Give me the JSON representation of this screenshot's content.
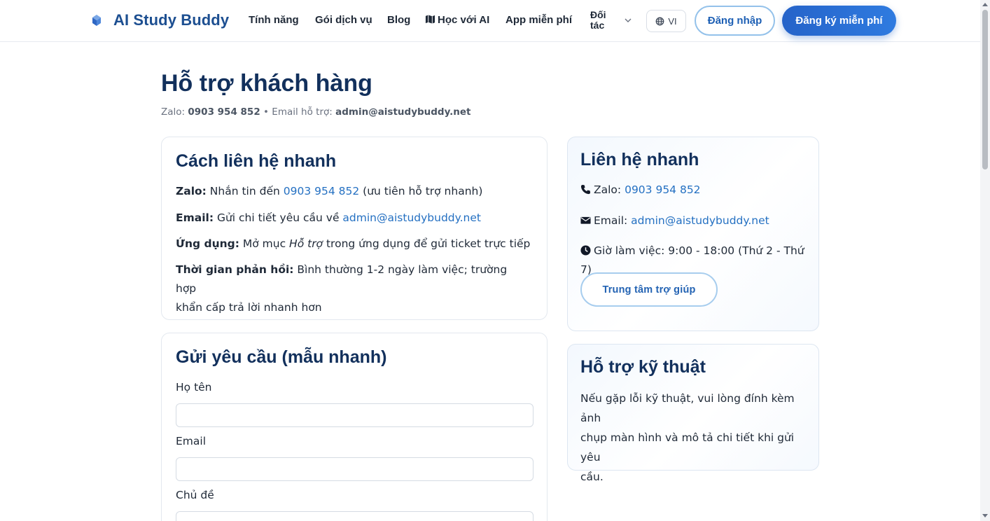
{
  "header": {
    "brand_name": "AI Study Buddy",
    "nav": {
      "features": "Tính năng",
      "plans": "Gói dịch vụ",
      "blog": "Blog",
      "learn_ai": "Học với AI",
      "free_app": "App miễn phí",
      "partners_line1": "Đối",
      "partners_line2": "tác"
    },
    "language": "VI",
    "login_label": "Đăng nhập",
    "signup_label": "Đăng ký miễn phí"
  },
  "page": {
    "title": "Hỗ trợ khách hàng",
    "subtitle_zalo_label": "Zalo:",
    "subtitle_zalo_value": "0903 954 852",
    "subtitle_separator": "•",
    "subtitle_email_label": "Email hỗ trợ:",
    "subtitle_email_value": "admin@aistudybuddy.net"
  },
  "quick_contact_card": {
    "title": "Cách liên hệ nhanh",
    "zalo_label": "Zalo:",
    "zalo_text": "Nhắn tin đến",
    "zalo_phone": "0903 954 852",
    "zalo_note": "(ưu tiên hỗ trợ nhanh)",
    "email_label": "Email:",
    "email_text": "Gửi chi tiết yêu cầu về",
    "email_value": "admin@aistudybuddy.net",
    "app_label": "Ứng dụng:",
    "app_text_before": "Mở mục",
    "app_text_em": "Hỗ trợ",
    "app_text_after": "trong ứng dụng để gửi ticket trực tiếp",
    "response_label": "Thời gian phản hồi:",
    "response_text_line1": "Bình thường 1-2 ngày làm việc; trường hợp",
    "response_text_line2": "khẩn cấp trả lời nhanh hơn"
  },
  "request_form_card": {
    "title": "Gửi yêu cầu (mẫu nhanh)",
    "name_label": "Họ tên",
    "name_value": "",
    "email_label": "Email",
    "email_value": "",
    "subject_label": "Chủ đề",
    "subject_value": ""
  },
  "sidebar_contact_card": {
    "title": "Liên hệ nhanh",
    "zalo_label": "Zalo:",
    "zalo_value": "0903 954 852",
    "email_label": "Email:",
    "email_value": "admin@aistudybuddy.net",
    "hours_text": "Giờ làm việc: 9:00 - 18:00 (Thứ 2 - Thứ 7)",
    "help_center_label": "Trung tâm trợ giúp"
  },
  "tech_support_card": {
    "title": "Hỗ trợ kỹ thuật",
    "text_line1": "Nếu gặp lỗi kỹ thuật, vui lòng đính kèm ảnh",
    "text_line2": "chụp màn hình và mô tả chi tiết khi gửi yêu",
    "text_line3": "cầu."
  },
  "colors": {
    "brand": "#1d4f91",
    "heading": "#12305c",
    "link": "#2470c2",
    "primary_button": "#2563c9"
  },
  "icons": [
    "brand-logo-icon",
    "map-icon",
    "chevron-down-icon",
    "globe-icon",
    "phone-icon",
    "envelope-icon",
    "clock-icon"
  ]
}
